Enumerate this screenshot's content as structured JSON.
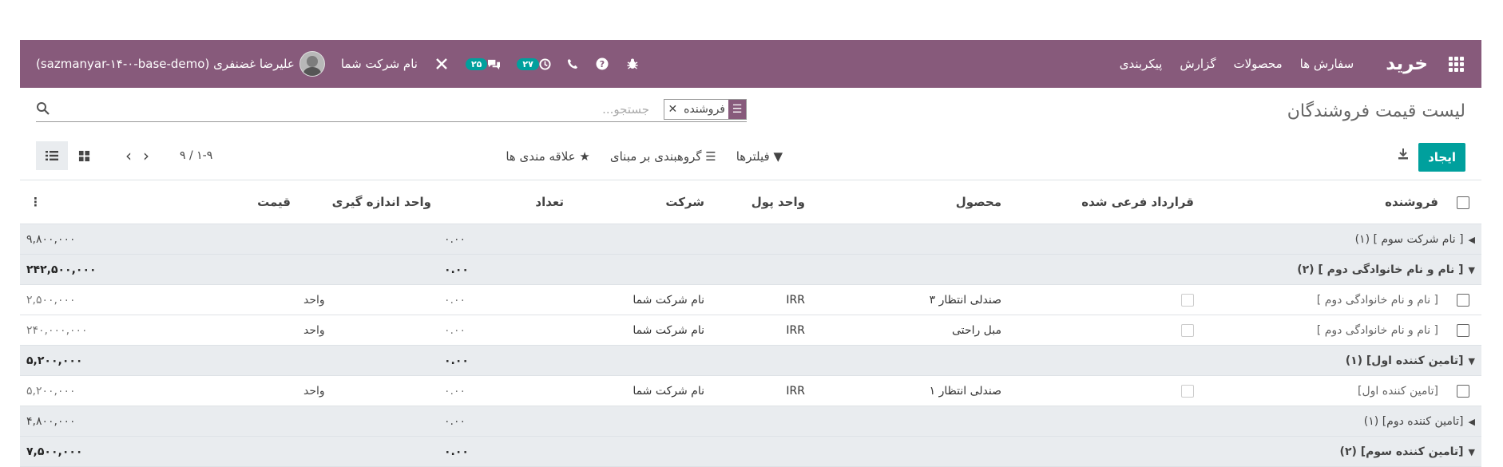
{
  "topbar": {
    "brand": "خرید",
    "menu": [
      "سفارش ها",
      "محصولات",
      "گزارش",
      "پیکربندی"
    ],
    "activity_count": "۲۷",
    "messages_count": "۲۵",
    "company": "نام شرکت شما",
    "user": "علیرضا غضنفری (sazmanyar-۱۴-۰-base-demo)"
  },
  "title": "لیست قیمت فروشندگان",
  "search": {
    "facet_label": "فروشنده",
    "placeholder": "جستجو..."
  },
  "toolbar": {
    "create": "ایجاد",
    "filters": "فیلترها",
    "groupby": "گروهبندی بر مبنای",
    "favorites": "علاقه مندی ها",
    "pager": "۱-۹ / ۹"
  },
  "columns": {
    "vendor": "فروشنده",
    "subcontract": "قرارداد فرعی شده",
    "product": "محصول",
    "currency": "واحد پول",
    "company": "شرکت",
    "quantity": "تعداد",
    "uom": "واحد اندازه گیری",
    "price": "قیمت"
  },
  "rows": [
    {
      "type": "group",
      "open": false,
      "label": "[ نام شرکت سوم ] (۱)",
      "qty": "۰.۰۰",
      "price": "۹,۸۰۰,۰۰۰"
    },
    {
      "type": "group",
      "open": true,
      "label": "[ نام و نام خانوادگی دوم ] (۲)",
      "qty": "۰.۰۰",
      "price": "۲۴۲,۵۰۰,۰۰۰"
    },
    {
      "type": "record",
      "vendor": "[ نام و نام خانوادگی دوم ]",
      "product": "صندلی انتظار ۳",
      "currency": "IRR",
      "company": "نام شرکت شما",
      "qty": "۰.۰۰",
      "uom": "واحد",
      "price": "۲,۵۰۰,۰۰۰"
    },
    {
      "type": "record",
      "vendor": "[ نام و نام خانوادگی دوم ]",
      "product": "مبل راحتی",
      "currency": "IRR",
      "company": "نام شرکت شما",
      "qty": "۰.۰۰",
      "uom": "واحد",
      "price": "۲۴۰,۰۰۰,۰۰۰"
    },
    {
      "type": "group",
      "open": true,
      "label": "[تامین کننده اول] (۱)",
      "qty": "۰.۰۰",
      "price": "۵,۲۰۰,۰۰۰"
    },
    {
      "type": "record",
      "vendor": "[تامین کننده اول]",
      "product": "صندلی انتظار ۱",
      "currency": "IRR",
      "company": "نام شرکت شما",
      "qty": "۰.۰۰",
      "uom": "واحد",
      "price": "۵,۲۰۰,۰۰۰"
    },
    {
      "type": "group",
      "open": false,
      "label": "[تامین کننده دوم] (۱)",
      "qty": "۰.۰۰",
      "price": "۴,۸۰۰,۰۰۰"
    },
    {
      "type": "group",
      "open": true,
      "label": "[تامین کننده سوم] (۲)",
      "qty": "۰.۰۰",
      "price": "۷,۵۰۰,۰۰۰"
    }
  ],
  "colors": {
    "brand": "#875A7B",
    "accent": "#00A09D"
  }
}
